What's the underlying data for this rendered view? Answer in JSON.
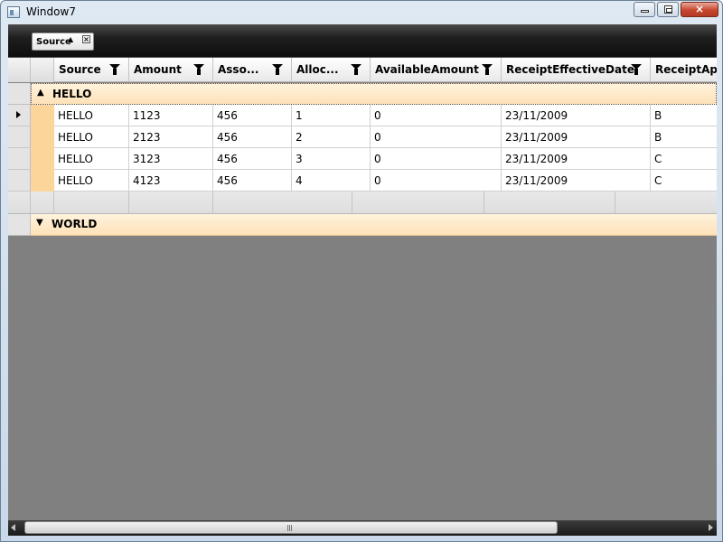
{
  "window": {
    "title": "Window7",
    "close_glyph": "×"
  },
  "group_panel": {
    "chip_label": "Source",
    "chip_sort_glyph": "▲",
    "chip_close_glyph": "×"
  },
  "columns": [
    "Source",
    "Amount",
    "Asso...",
    "Alloc...",
    "AvailableAmount",
    "ReceiptEffectiveDate",
    "ReceiptAppl"
  ],
  "groups": [
    {
      "label": "HELLO",
      "expanded": true,
      "chevron": "▲",
      "rows": [
        [
          "HELLO",
          "1123",
          "456",
          "1",
          "0",
          "23/11/2009",
          "B"
        ],
        [
          "HELLO",
          "2123",
          "456",
          "2",
          "0",
          "23/11/2009",
          "B"
        ],
        [
          "HELLO",
          "3123",
          "456",
          "3",
          "0",
          "23/11/2009",
          "C"
        ],
        [
          "HELLO",
          "4123",
          "456",
          "4",
          "0",
          "23/11/2009",
          "C"
        ]
      ]
    },
    {
      "label": "WORLD",
      "expanded": false,
      "chevron": "▼",
      "rows": []
    }
  ],
  "scrollbar": {
    "grip_glyph": "|||"
  },
  "colors": {
    "group_header": "#fde2b8",
    "row_indent": "#fcd59a",
    "background": "#808080",
    "group_panel": "#1f1f1f"
  },
  "icons": [
    "window-icon",
    "minimize-icon",
    "maximize-icon",
    "close-icon",
    "filter-icon",
    "collapse-chevron-icon",
    "expand-chevron-icon",
    "current-row-arrow-icon",
    "scroll-left-icon",
    "scroll-right-icon"
  ]
}
